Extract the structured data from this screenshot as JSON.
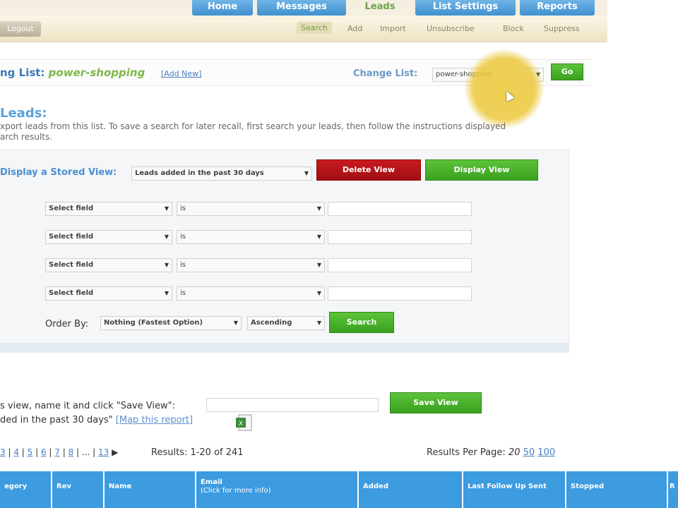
{
  "nav": {
    "tabs": [
      "Home",
      "Messages",
      "Leads",
      "List Settings",
      "Reports"
    ],
    "left_button": "Logout",
    "subnav": [
      "Search",
      "Add",
      "Import",
      "Unsubscribe",
      "Block",
      "Suppress"
    ]
  },
  "list_bar": {
    "label_prefix": "ng List: ",
    "list_name": "power-shopping",
    "add_new": "[Add New]",
    "change_label": "Change List:",
    "change_value": "power-shopping",
    "go_label": "Go"
  },
  "leads": {
    "title": "Leads:",
    "description_line1": "xport leads from this list. To save a search for later recall, first search your leads, then follow the instructions displayed",
    "description_line2": "arch results."
  },
  "search": {
    "stored_view_label": "Display a Stored View:",
    "stored_view_value": "Leads added in the past 30 days",
    "delete_view": "Delete View",
    "display_view": "Display View",
    "rows": [
      {
        "field": "Select field",
        "op": "is"
      },
      {
        "field": "Select field",
        "op": "is"
      },
      {
        "field": "Select field",
        "op": "is"
      },
      {
        "field": "Select field",
        "op": "is"
      }
    ],
    "order_by_label": "Order By:",
    "order_by_value": "Nothing (Fastest Option)",
    "direction_value": "Ascending",
    "search_button": "Search"
  },
  "save_view": {
    "text": "s view, name it and click \"Save View\":",
    "button": "Save View",
    "current_view_text": "ded in the past 30 days\"",
    "map_link": "[Map this report]"
  },
  "pagination": {
    "pages": [
      "3",
      "4",
      "5",
      "6",
      "7",
      "8",
      "...",
      "13"
    ],
    "next_arrow": "▶",
    "results_text": "Results: 1-20 of 241",
    "per_page_label": "Results Per Page:",
    "per_page_current": "20",
    "per_page_options": [
      "50",
      "100"
    ]
  },
  "table": {
    "columns": [
      {
        "label": "egory",
        "sub": ""
      },
      {
        "label": "Rev",
        "sub": ""
      },
      {
        "label": "Name",
        "sub": ""
      },
      {
        "label": "Email",
        "sub": "(Click for more info)"
      },
      {
        "label": "Added",
        "sub": ""
      },
      {
        "label": "Last Follow Up Sent",
        "sub": ""
      },
      {
        "label": "Stopped",
        "sub": ""
      },
      {
        "label": "R",
        "sub": ""
      }
    ]
  },
  "colors": {
    "accent_blue": "#3d9be0",
    "green_button": "#3aa11f",
    "red_button": "#a10f12",
    "list_name_green": "#7fb848"
  }
}
